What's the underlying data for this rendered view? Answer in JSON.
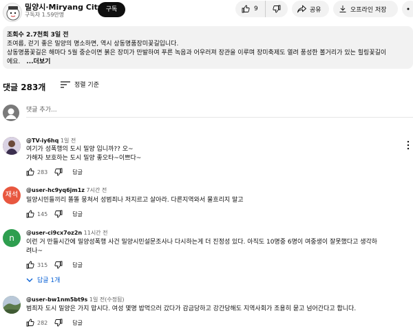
{
  "channel": {
    "name": "밀양시·Miryang City",
    "subscribers": "구독자 1.59만명",
    "subscribe_label": "구독",
    "avatar_icon": "miryang-mascot-logo"
  },
  "actions": {
    "like_count": "9",
    "share_label": "공유",
    "offline_label": "오프라인 저장",
    "like_icon": "thumb-up-icon",
    "dislike_icon": "thumb-down-icon",
    "share_icon": "share-icon",
    "download_icon": "download-icon",
    "more_icon": "more-horizontal-icon"
  },
  "description": {
    "stats": "조회수 2.7천회  3일 전",
    "line1": "조여름, 걷기 좋은 밀양의 명소하면, 역시 상동명품장미꽃길입니다.",
    "line2": "상동명품꽃길은 해마다 5월 중순이면 붉은 장미가 만발하여 푸른 녹음과 어우러져 장관을 이루며 장미축제도 열려 풍성한 볼거리가 있는 힐링꽃길이",
    "line3": "에요.",
    "more": "...더보기"
  },
  "comments_header": {
    "count_label": "댓글 283개",
    "sort_label": "정렬 기준",
    "add_placeholder": "댓글 추가..."
  },
  "comments": [
    {
      "author": "@TV-iy6hq",
      "time": "1일 전",
      "lines": [
        "여기가 성폭행의 도시 밀양 입니까?? 오~",
        "가해자 보호하는 도시 밀양 좋오타~이쁘다~"
      ],
      "likes": "283",
      "reply_label": "답글",
      "avatar_color": "#7a4a3a"
    },
    {
      "author": "@user-hc9yq6jm1z",
      "time": "7시간 전",
      "lines": [
        "밀양시민들끼리 똘똘 뭉쳐서 성범죄나 저지르고 살아라. 다른지역와서 물흐리지 말고"
      ],
      "likes": "145",
      "reply_label": "답글",
      "avatar_text": "재석",
      "avatar_color": "#e8573f"
    },
    {
      "author": "@user-ci9cx7oz2n",
      "time": "11시간 전",
      "lines": [
        "이런 거 만들시간에 밀양성폭행 사건 밀양시민설문조사나 다시하는게 더 진정성 있다. 아직도 10명중 6명이 여중생이 잘못했다고 생각하",
        "려나~"
      ],
      "likes": "315",
      "reply_label": "답글",
      "avatar_text": "n",
      "avatar_color": "#2e9e4f",
      "replies_label": "답글 1개"
    },
    {
      "author": "@user-bw1nm5bt9s",
      "time": "1일 전(수정됨)",
      "lines": [
        "범죄자 도시 밀양은 가지 맙시다. 여성 몇명 밥먹으러 갔다가 감금당하고 강간당해도 지역사회가 조용히 묻고 넘어간다고 합니다."
      ],
      "likes": "282",
      "reply_label": "답글",
      "avatar_color": "#6b8a5a"
    }
  ]
}
